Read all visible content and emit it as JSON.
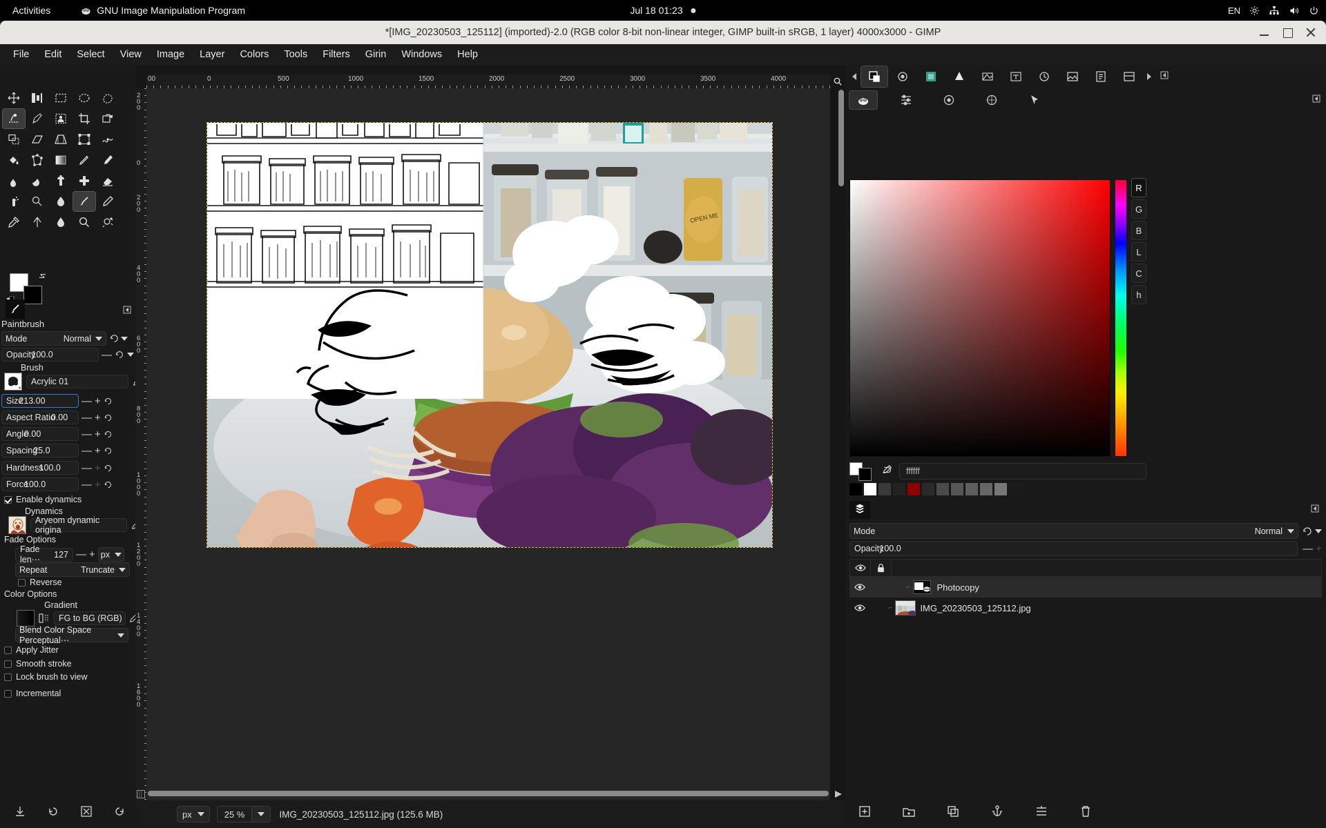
{
  "gnome": {
    "activities": "Activities",
    "app_name": "GNU Image Manipulation Program",
    "clock": "Jul 18  01:23",
    "keyboard": "EN"
  },
  "window": {
    "title": "*[IMG_20230503_125112] (imported)-2.0 (RGB color 8-bit non-linear integer, GIMP built-in sRGB, 1 layer) 4000x3000  -  GIMP"
  },
  "menu": {
    "items": [
      "File",
      "Edit",
      "Select",
      "View",
      "Image",
      "Layer",
      "Colors",
      "Tools",
      "Filters",
      "Girin",
      "Windows",
      "Help"
    ]
  },
  "toolbox": {
    "tools": [
      "move-tool",
      "alignment-tool",
      "rectangle-select-tool",
      "ellipse-select-tool",
      "free-select-tool",
      "fuzzy-select-tool",
      "paths-tool",
      "foreground-select-tool",
      "crop-tool",
      "transform-tool",
      "warp-tool",
      "bucket-fill-tool",
      "gradient-tool",
      "shear-tool",
      "perspective-tool",
      "cage-transform-tool",
      "smudge-tool",
      "measure-tool",
      "unified-transform-tool",
      "clone-tool",
      "pattern-tool",
      "scissors-tool",
      "heal-tool",
      "paintbrush-tool",
      "pencil-tool",
      "airbrush-tool",
      "ink-tool",
      "eraser-tool",
      "mypaint-brush-tool",
      "text-tool",
      "color-picker-tool",
      "path-edit-tool",
      "zoom-tool",
      "gegl-operation-tool"
    ],
    "selected_tool": "paintbrush-tool"
  },
  "tool_options": {
    "title": "Paintbrush",
    "mode": {
      "label": "Mode",
      "value": "Normal"
    },
    "opacity": {
      "label": "Opacity",
      "value": "100.0"
    },
    "brush": {
      "label": "Brush",
      "value": "Acrylic 01"
    },
    "size": {
      "label": "Size",
      "value": "213.00"
    },
    "aspect_ratio": {
      "label": "Aspect Ratio",
      "value": "0.00"
    },
    "angle": {
      "label": "Angle",
      "value": "0.00"
    },
    "spacing": {
      "label": "Spacing",
      "value": "25.0"
    },
    "hardness": {
      "label": "Hardness",
      "value": "100.0"
    },
    "force": {
      "label": "Force",
      "value": "100.0"
    },
    "enable_dynamics": {
      "label": "Enable dynamics",
      "checked": true
    },
    "dynamics": {
      "label": "Dynamics",
      "value": "Aryeom dynamic origina"
    },
    "fade_options": {
      "label": "Fade Options"
    },
    "fade_length": {
      "label": "Fade len⋯",
      "value": "127",
      "unit": "px"
    },
    "repeat": {
      "label": "Repeat",
      "value": "Truncate"
    },
    "reverse": {
      "label": "Reverse",
      "checked": false
    },
    "color_options": {
      "label": "Color Options"
    },
    "gradient": {
      "label": "Gradient",
      "value": "FG to BG (RGB)"
    },
    "blend_color_space": {
      "value": "Blend Color Space Perceptual⋯"
    },
    "apply_jitter": {
      "label": "Apply Jitter",
      "checked": false
    },
    "smooth_stroke": {
      "label": "Smooth stroke",
      "checked": false
    },
    "lock_brush_to_view": {
      "label": "Lock brush to view",
      "checked": false
    },
    "incremental": {
      "label": "Incremental",
      "checked": false
    }
  },
  "rulers": {
    "h_labels": [
      "00",
      "0",
      "500",
      "1000",
      "1500",
      "2000",
      "2500",
      "3000",
      "3500",
      "4000"
    ],
    "v_labels": [
      "2 0 0",
      "0",
      "2 0 0",
      "4 0 0",
      "6 0 0",
      "8 0 0",
      "1 0 0 0",
      "1 2 0 0",
      "1 4 0 0",
      "1 6 0 0"
    ]
  },
  "statusbar": {
    "unit": "px",
    "zoom": "25 %",
    "file_info": "IMG_20230503_125112.jpg (125.6 MB)"
  },
  "color_picker": {
    "channels": [
      "R",
      "G",
      "B",
      "L",
      "C",
      "h"
    ],
    "selected_channel": "R",
    "hex_value": "ffffff",
    "foreground": "#ffffff",
    "background": "#000000",
    "palette": [
      "#000000",
      "#ffffff",
      "#3a3a3a",
      "#222222",
      "#8c0000",
      "#2a2a2a",
      "#4a4a4a",
      "#565656",
      "#5e5e5e",
      "#666666",
      "#777777",
      "#1a1a1a"
    ]
  },
  "layers_panel": {
    "mode": {
      "label": "Mode",
      "value": "Normal"
    },
    "opacity": {
      "label": "Opacity",
      "value": "100.0"
    },
    "columns": [
      "visibility-icon",
      "lock-icon"
    ],
    "layers": [
      {
        "name": "Photocopy",
        "visible": true,
        "selected": true,
        "kind": "filter-layer"
      },
      {
        "name": "IMG_20230503_125112.jpg",
        "visible": true,
        "selected": false,
        "kind": "image-layer"
      }
    ]
  },
  "bottom_dock_buttons": {
    "left": [
      "save-icon",
      "refresh-icon",
      "delete-icon",
      "reset-icon"
    ],
    "right": [
      "new-layer-icon",
      "new-group-icon",
      "duplicate-layer-icon",
      "anchor-layer-icon",
      "merge-down-icon",
      "delete-layer-icon"
    ]
  }
}
